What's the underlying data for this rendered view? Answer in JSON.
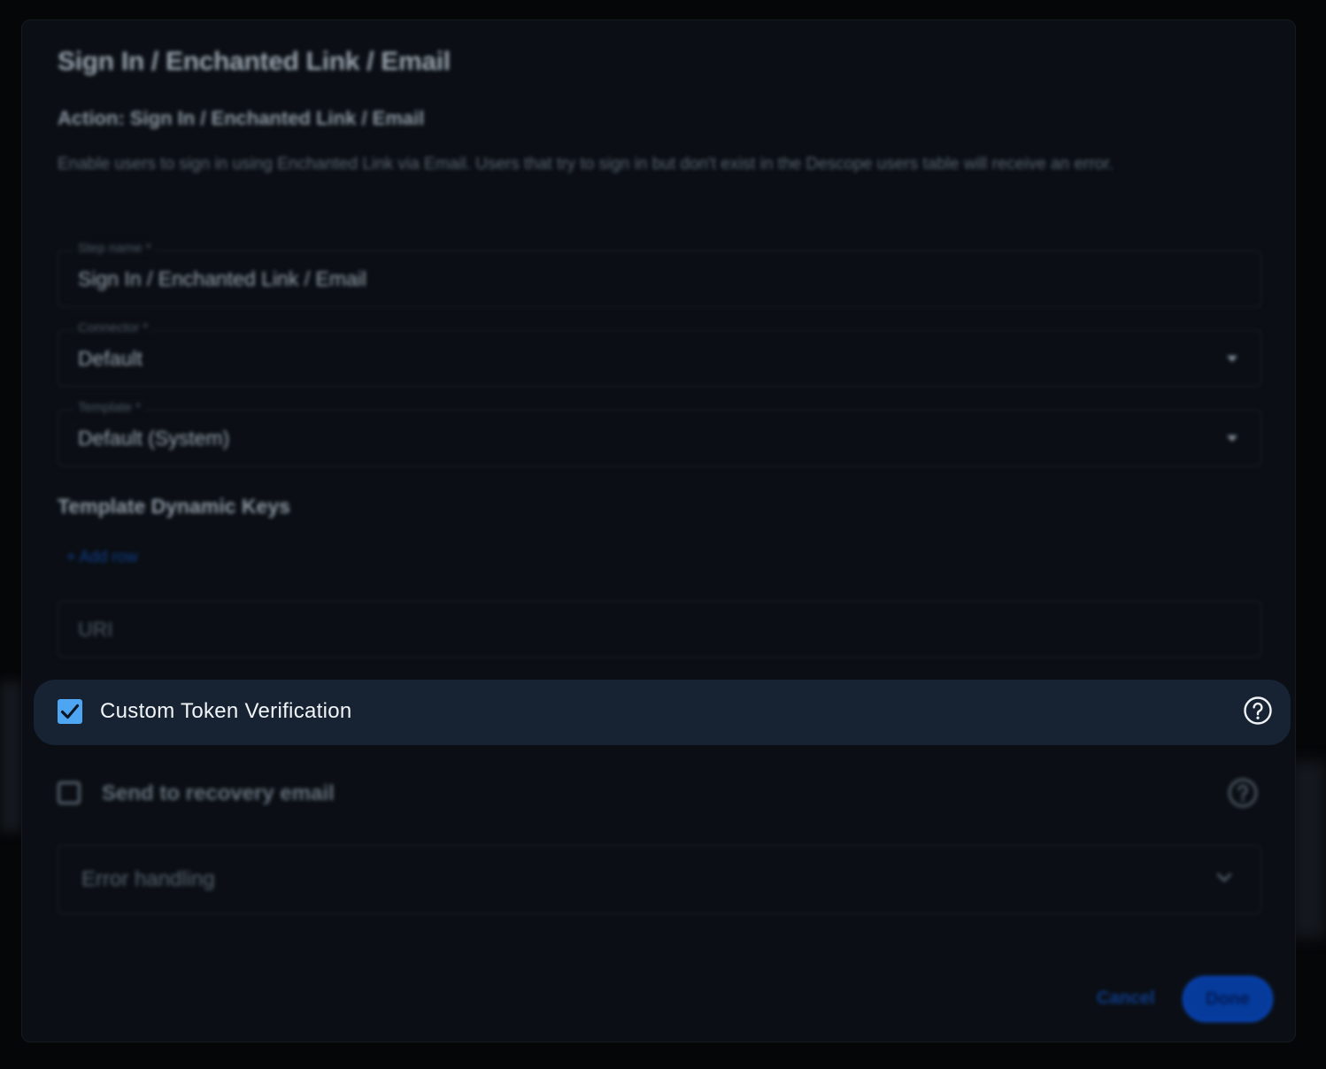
{
  "modal": {
    "title": "Sign In / Enchanted Link / Email",
    "action_title": "Action: Sign In / Enchanted Link / Email",
    "description": "Enable users to sign in using Enchanted Link via Email. Users that try to sign in but don't exist in the Descope users table will receive an error."
  },
  "fields": {
    "step_name": {
      "label": "Step name *",
      "value": "Sign In / Enchanted Link / Email"
    },
    "connector": {
      "label": "Connector *",
      "value": "Default"
    },
    "template": {
      "label": "Template *",
      "value": "Default (System)"
    }
  },
  "dynamic_keys": {
    "heading": "Template Dynamic Keys",
    "add_row_label": "+ Add row"
  },
  "uri": {
    "placeholder": "URI"
  },
  "options": {
    "custom_token": {
      "label": "Custom Token Verification",
      "checked": true
    },
    "recovery_email": {
      "label": "Send to recovery email",
      "checked": false
    }
  },
  "error_handling": {
    "label": "Error handling"
  },
  "footer": {
    "cancel_label": "Cancel",
    "done_label": "Done"
  },
  "colors": {
    "accent": "#4ea6f2",
    "highlight_bg": "#172233",
    "modal_bg": "#0b0f15"
  },
  "icons": {
    "help": "help-circle-icon",
    "check": "check-icon",
    "dropdown": "caret-down-icon",
    "expand": "chevron-down-icon"
  }
}
